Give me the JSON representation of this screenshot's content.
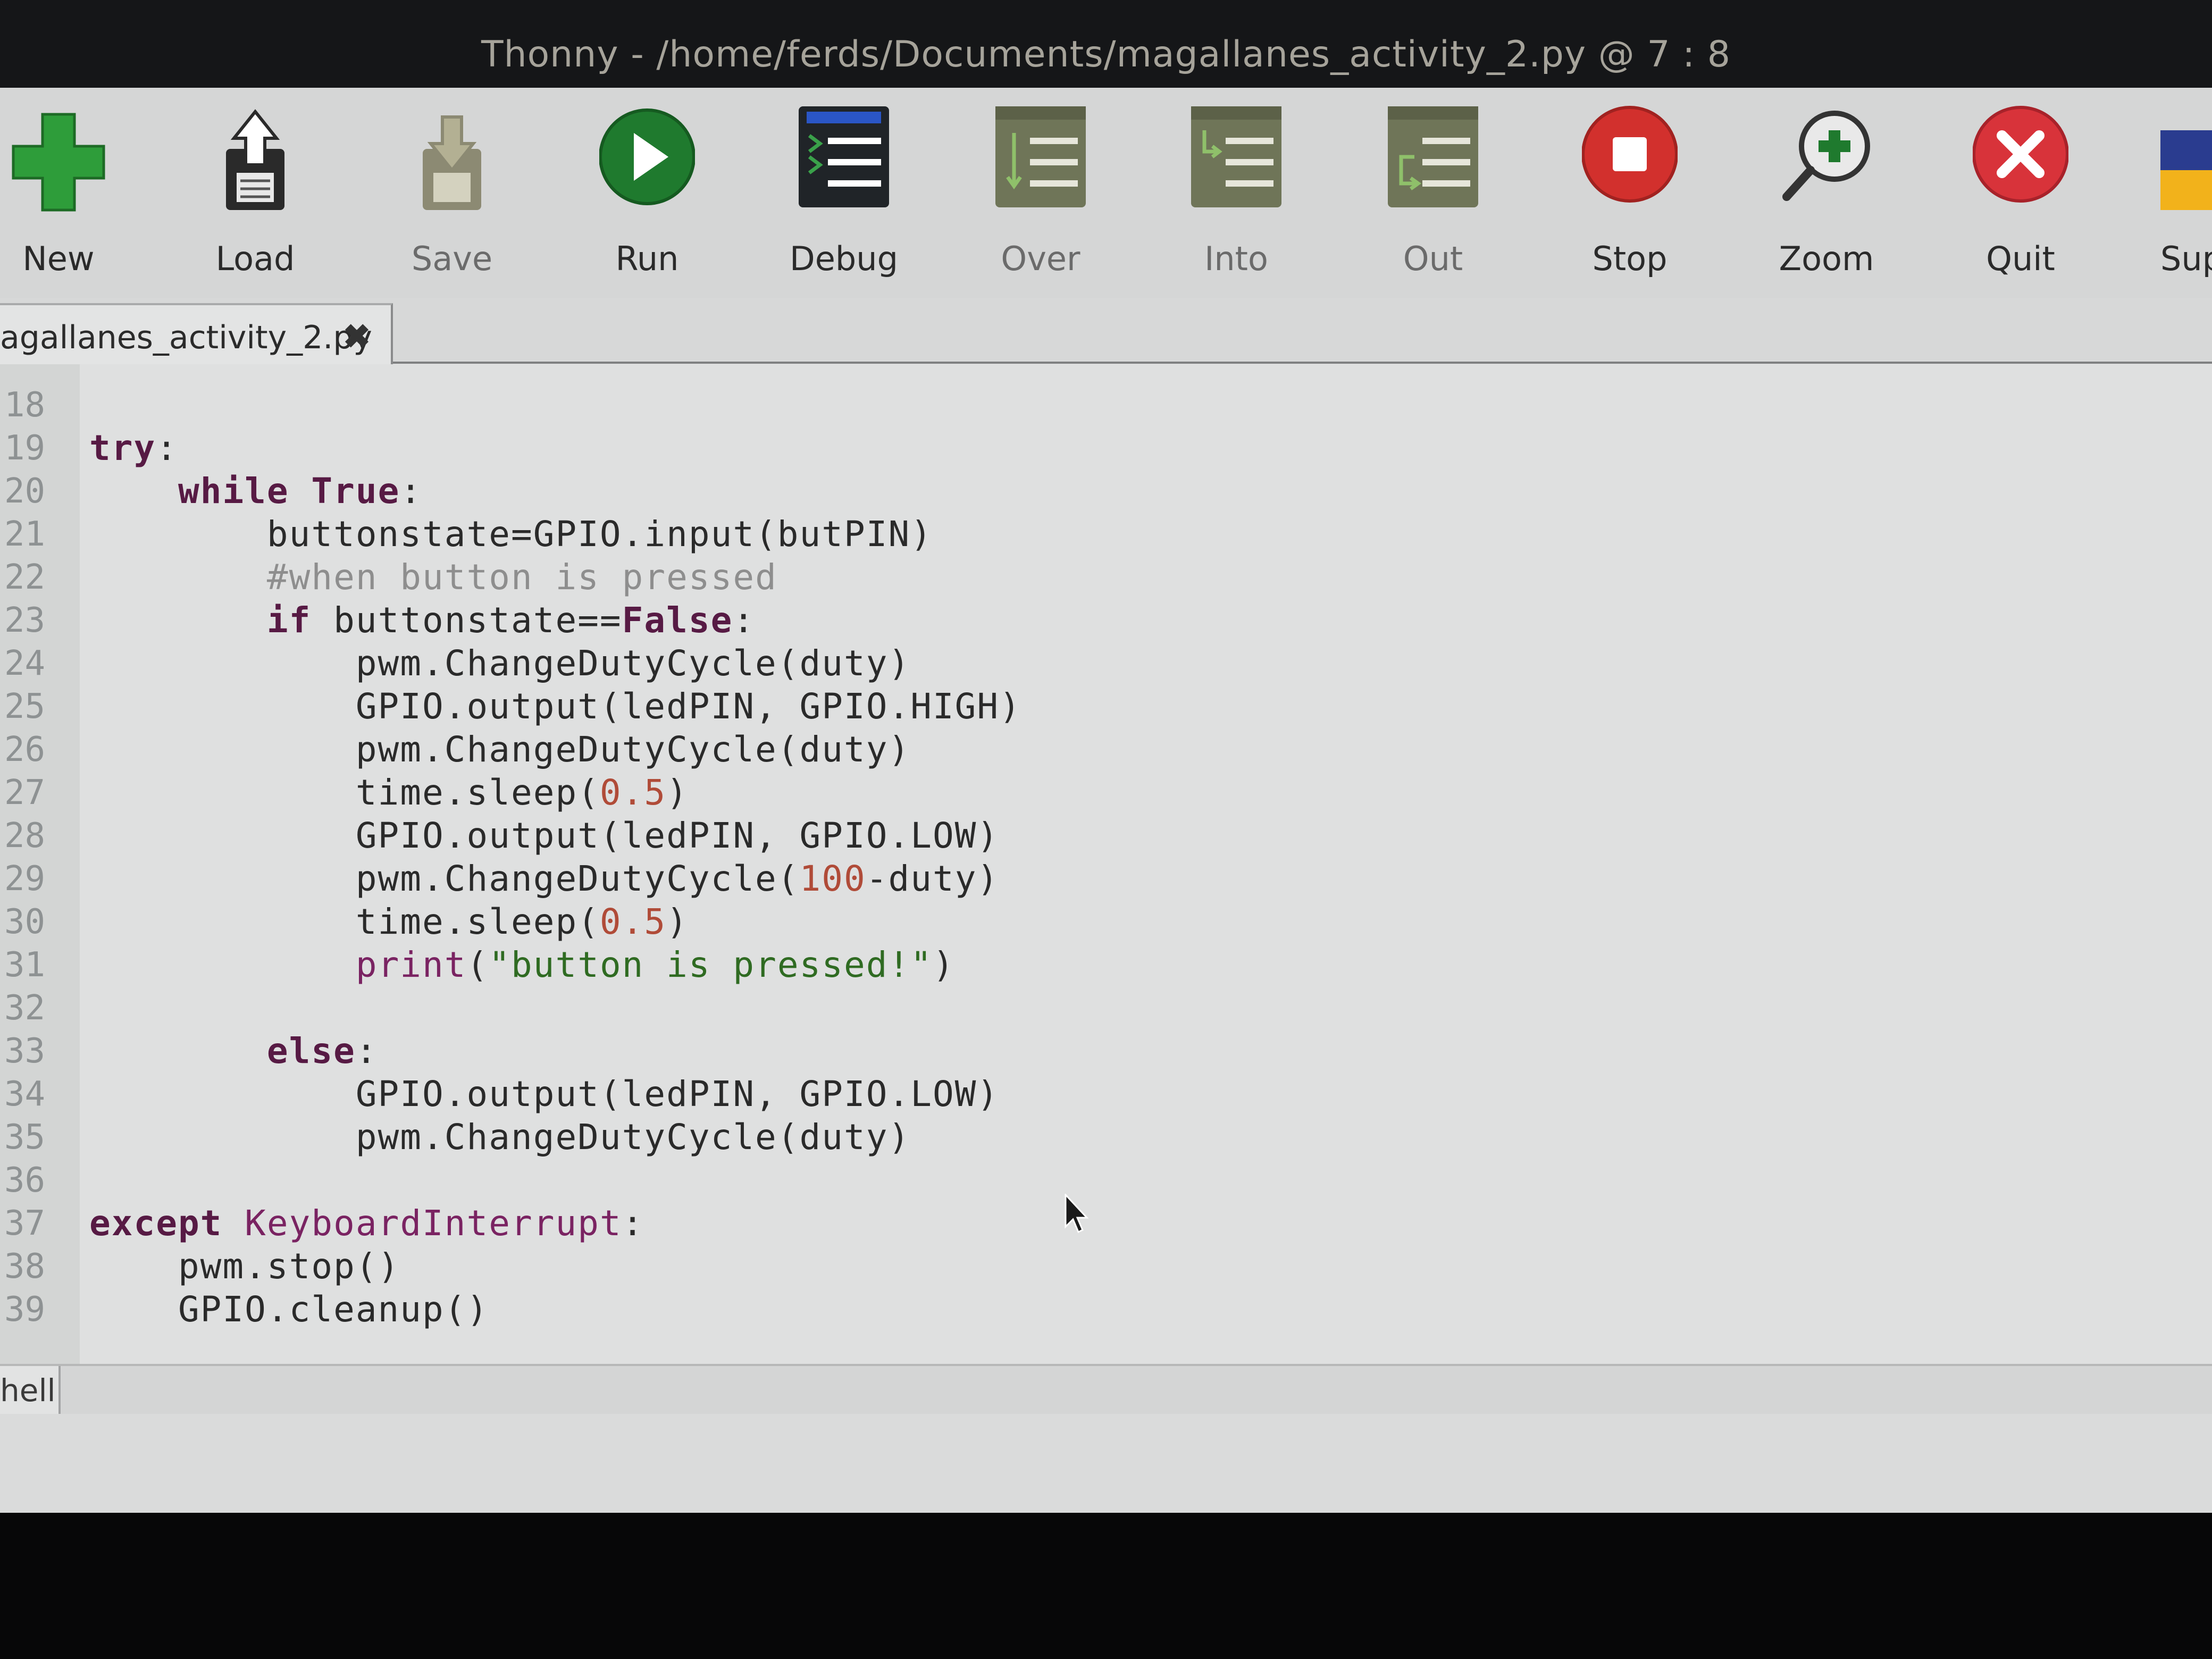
{
  "window": {
    "title": "Thonny  -  /home/ferds/Documents/magallanes_activity_2.py  @  7 : 8"
  },
  "toolbar": {
    "buttons": [
      {
        "label": "New",
        "icon": "new-file-plus-icon"
      },
      {
        "label": "Load",
        "icon": "load-folder-icon"
      },
      {
        "label": "Save",
        "icon": "save-icon"
      },
      {
        "label": "Run",
        "icon": "run-play-icon"
      },
      {
        "label": "Debug",
        "icon": "debug-icon"
      },
      {
        "label": "Over",
        "icon": "step-over-icon"
      },
      {
        "label": "Into",
        "icon": "step-into-icon"
      },
      {
        "label": "Out",
        "icon": "step-out-icon"
      },
      {
        "label": "Stop",
        "icon": "stop-icon"
      },
      {
        "label": "Zoom",
        "icon": "zoom-icon"
      },
      {
        "label": "Quit",
        "icon": "quit-icon"
      },
      {
        "label": "Sup",
        "icon": "support-icon"
      }
    ]
  },
  "editor": {
    "tab_label": "agallanes_activity_2.py",
    "tab_close": "✖",
    "lines": [
      {
        "num": "18",
        "tokens": []
      },
      {
        "num": "19",
        "tokens": [
          {
            "t": "try",
            "c": "kw"
          },
          {
            "t": ":",
            "c": "p"
          }
        ]
      },
      {
        "num": "20",
        "tokens": [
          {
            "t": "    ",
            "c": "p"
          },
          {
            "t": "while True",
            "c": "kw"
          },
          {
            "t": ":",
            "c": "p"
          }
        ]
      },
      {
        "num": "21",
        "tokens": [
          {
            "t": "        buttonstate=GPIO.input(butPIN)",
            "c": "p"
          }
        ]
      },
      {
        "num": "22",
        "tokens": [
          {
            "t": "        ",
            "c": "p"
          },
          {
            "t": "#when button is pressed",
            "c": "cm"
          }
        ]
      },
      {
        "num": "23",
        "tokens": [
          {
            "t": "        ",
            "c": "p"
          },
          {
            "t": "if",
            "c": "kw"
          },
          {
            "t": " buttonstate==",
            "c": "p"
          },
          {
            "t": "False",
            "c": "kw"
          },
          {
            "t": ":",
            "c": "p"
          }
        ]
      },
      {
        "num": "24",
        "tokens": [
          {
            "t": "            pwm.ChangeDutyCycle(duty)",
            "c": "p"
          }
        ]
      },
      {
        "num": "25",
        "tokens": [
          {
            "t": "            GPIO.output(ledPIN, GPIO.HIGH)",
            "c": "p"
          }
        ]
      },
      {
        "num": "26",
        "tokens": [
          {
            "t": "            pwm.ChangeDutyCycle(duty)",
            "c": "p"
          }
        ]
      },
      {
        "num": "27",
        "tokens": [
          {
            "t": "            time.sleep(",
            "c": "p"
          },
          {
            "t": "0.5",
            "c": "num"
          },
          {
            "t": ")",
            "c": "p"
          }
        ]
      },
      {
        "num": "28",
        "tokens": [
          {
            "t": "            GPIO.output(ledPIN, GPIO.LOW)",
            "c": "p"
          }
        ]
      },
      {
        "num": "29",
        "tokens": [
          {
            "t": "            pwm.ChangeDutyCycle(",
            "c": "p"
          },
          {
            "t": "100",
            "c": "num"
          },
          {
            "t": "-duty)",
            "c": "p"
          }
        ]
      },
      {
        "num": "30",
        "tokens": [
          {
            "t": "            time.sleep(",
            "c": "p"
          },
          {
            "t": "0.5",
            "c": "num"
          },
          {
            "t": ")",
            "c": "p"
          }
        ]
      },
      {
        "num": "31",
        "tokens": [
          {
            "t": "            ",
            "c": "p"
          },
          {
            "t": "print",
            "c": "bi"
          },
          {
            "t": "(",
            "c": "p"
          },
          {
            "t": "\"button is pressed!\"",
            "c": "str"
          },
          {
            "t": ")",
            "c": "p"
          }
        ]
      },
      {
        "num": "32",
        "tokens": []
      },
      {
        "num": "33",
        "tokens": [
          {
            "t": "        ",
            "c": "p"
          },
          {
            "t": "else",
            "c": "kw"
          },
          {
            "t": ":",
            "c": "p"
          }
        ]
      },
      {
        "num": "34",
        "tokens": [
          {
            "t": "            GPIO.output(ledPIN, GPIO.LOW)",
            "c": "p"
          }
        ]
      },
      {
        "num": "35",
        "tokens": [
          {
            "t": "            pwm.ChangeDutyCycle(duty)",
            "c": "p"
          }
        ]
      },
      {
        "num": "36",
        "tokens": []
      },
      {
        "num": "37",
        "tokens": [
          {
            "t": "except",
            "c": "kw"
          },
          {
            "t": " ",
            "c": "p"
          },
          {
            "t": "KeyboardInterrupt",
            "c": "bi"
          },
          {
            "t": ":",
            "c": "p"
          }
        ]
      },
      {
        "num": "38",
        "tokens": [
          {
            "t": "    pwm.stop()",
            "c": "p"
          }
        ]
      },
      {
        "num": "39",
        "tokens": [
          {
            "t": "    GPIO.cleanup()",
            "c": "p"
          }
        ]
      }
    ]
  },
  "shell": {
    "tab_label": "hell"
  },
  "colors": {
    "keyword": "#571a44",
    "builtin": "#7a2362",
    "number": "#b04b38",
    "string": "#2f6b22",
    "comment": "#8e8e8e"
  }
}
